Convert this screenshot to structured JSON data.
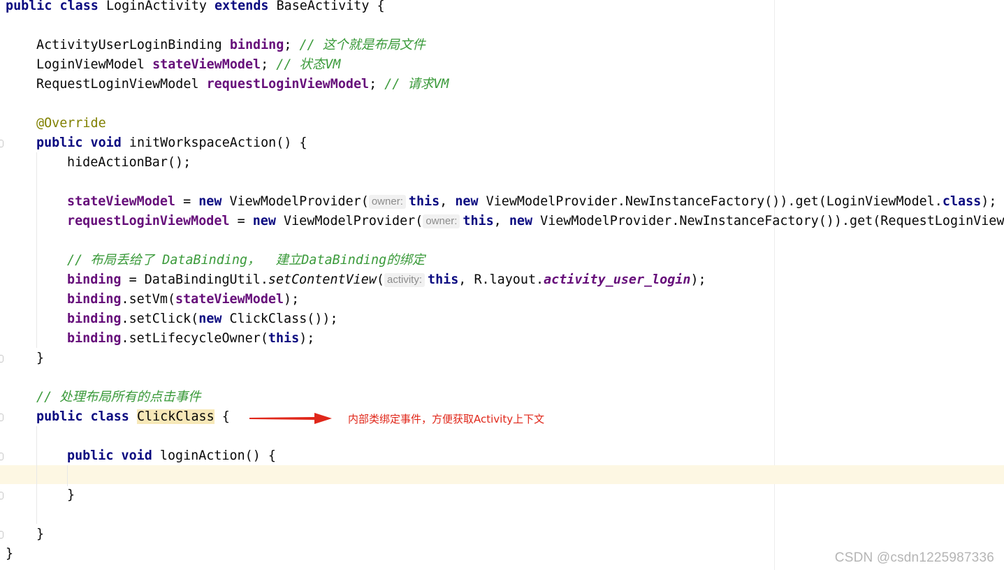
{
  "editor": {
    "caret_line_color": "#fdf7e3",
    "colors": {
      "keyword": "#0a0a80",
      "field": "#660e7a",
      "comment": "#3a9a3a",
      "annotation": "#808000",
      "text": "#080808"
    }
  },
  "code": {
    "l1": {
      "kw": "public class",
      "name": "LoginActivity",
      "kw2": "extends",
      "rest": "BaseActivity {"
    },
    "l3": {
      "type": "ActivityUserLoginBinding",
      "field": "binding",
      "semi": ";",
      "comment": "// 这个就是布局文件"
    },
    "l4": {
      "type": "LoginViewModel",
      "field": "stateViewModel",
      "semi": ";",
      "comment": "// 状态VM"
    },
    "l5": {
      "type": "RequestLoginViewModel",
      "field": "requestLoginViewModel",
      "semi": ";",
      "comment": "// 请求VM"
    },
    "l7": {
      "annotation": "@Override"
    },
    "l8": {
      "kw": "public void",
      "rest": "initWorkspaceAction() {"
    },
    "l9": {
      "text": "hideActionBar();"
    },
    "l11": {
      "field": "stateViewModel",
      "eq": " = ",
      "kw_new": "new",
      "mid": "ViewModelProvider(",
      "hint": "owner:",
      "kw_this": "this",
      "comma": ", ",
      "kw_new2": "new",
      "tail": "ViewModelProvider.NewInstanceFactory()).get(LoginViewModel.",
      "kw_class": "class",
      "end": ");"
    },
    "l12": {
      "field": "requestLoginViewModel",
      "eq": " = ",
      "kw_new": "new",
      "mid": "ViewModelProvider(",
      "hint": "owner:",
      "kw_this": "this",
      "comma": ", ",
      "kw_new2": "new",
      "tail": "ViewModelProvider.NewInstanceFactory()).get(RequestLoginView"
    },
    "l14": {
      "comment": "// 布局丢给了 DataBinding，  建立DataBinding的绑定"
    },
    "l15": {
      "field": "binding",
      "eq": " = DataBindingUtil.",
      "method": "setContentView",
      "paren": "(",
      "hint": "activity:",
      "kw_this": "this",
      "mid": ", R.layout.",
      "static_field": "activity_user_login",
      "end": ");"
    },
    "l16": {
      "field": "binding",
      "call": ".setVm(",
      "arg": "stateViewModel",
      "end": ");"
    },
    "l17": {
      "field": "binding",
      "call": ".setClick(",
      "kw_new": "new",
      "rest": " ClickClass());"
    },
    "l18": {
      "field": "binding",
      "call": ".setLifecycleOwner(",
      "kw_this": "this",
      "end": ");"
    },
    "l19": {
      "text": "}"
    },
    "l21": {
      "comment": "// 处理布局所有的点击事件"
    },
    "l22": {
      "kw": "public class",
      "name": "ClickClass",
      "rest": " {"
    },
    "l24": {
      "kw": "public void",
      "rest": "loginAction() {"
    },
    "l26": {
      "text": "}"
    },
    "l28": {
      "text": "}"
    },
    "l29": {
      "text": "}"
    }
  },
  "callout": {
    "text": "内部类绑定事件，方便获取Activity上下文",
    "color": "#e0271a"
  },
  "watermark": {
    "text": "CSDN @csdn1225987336"
  }
}
